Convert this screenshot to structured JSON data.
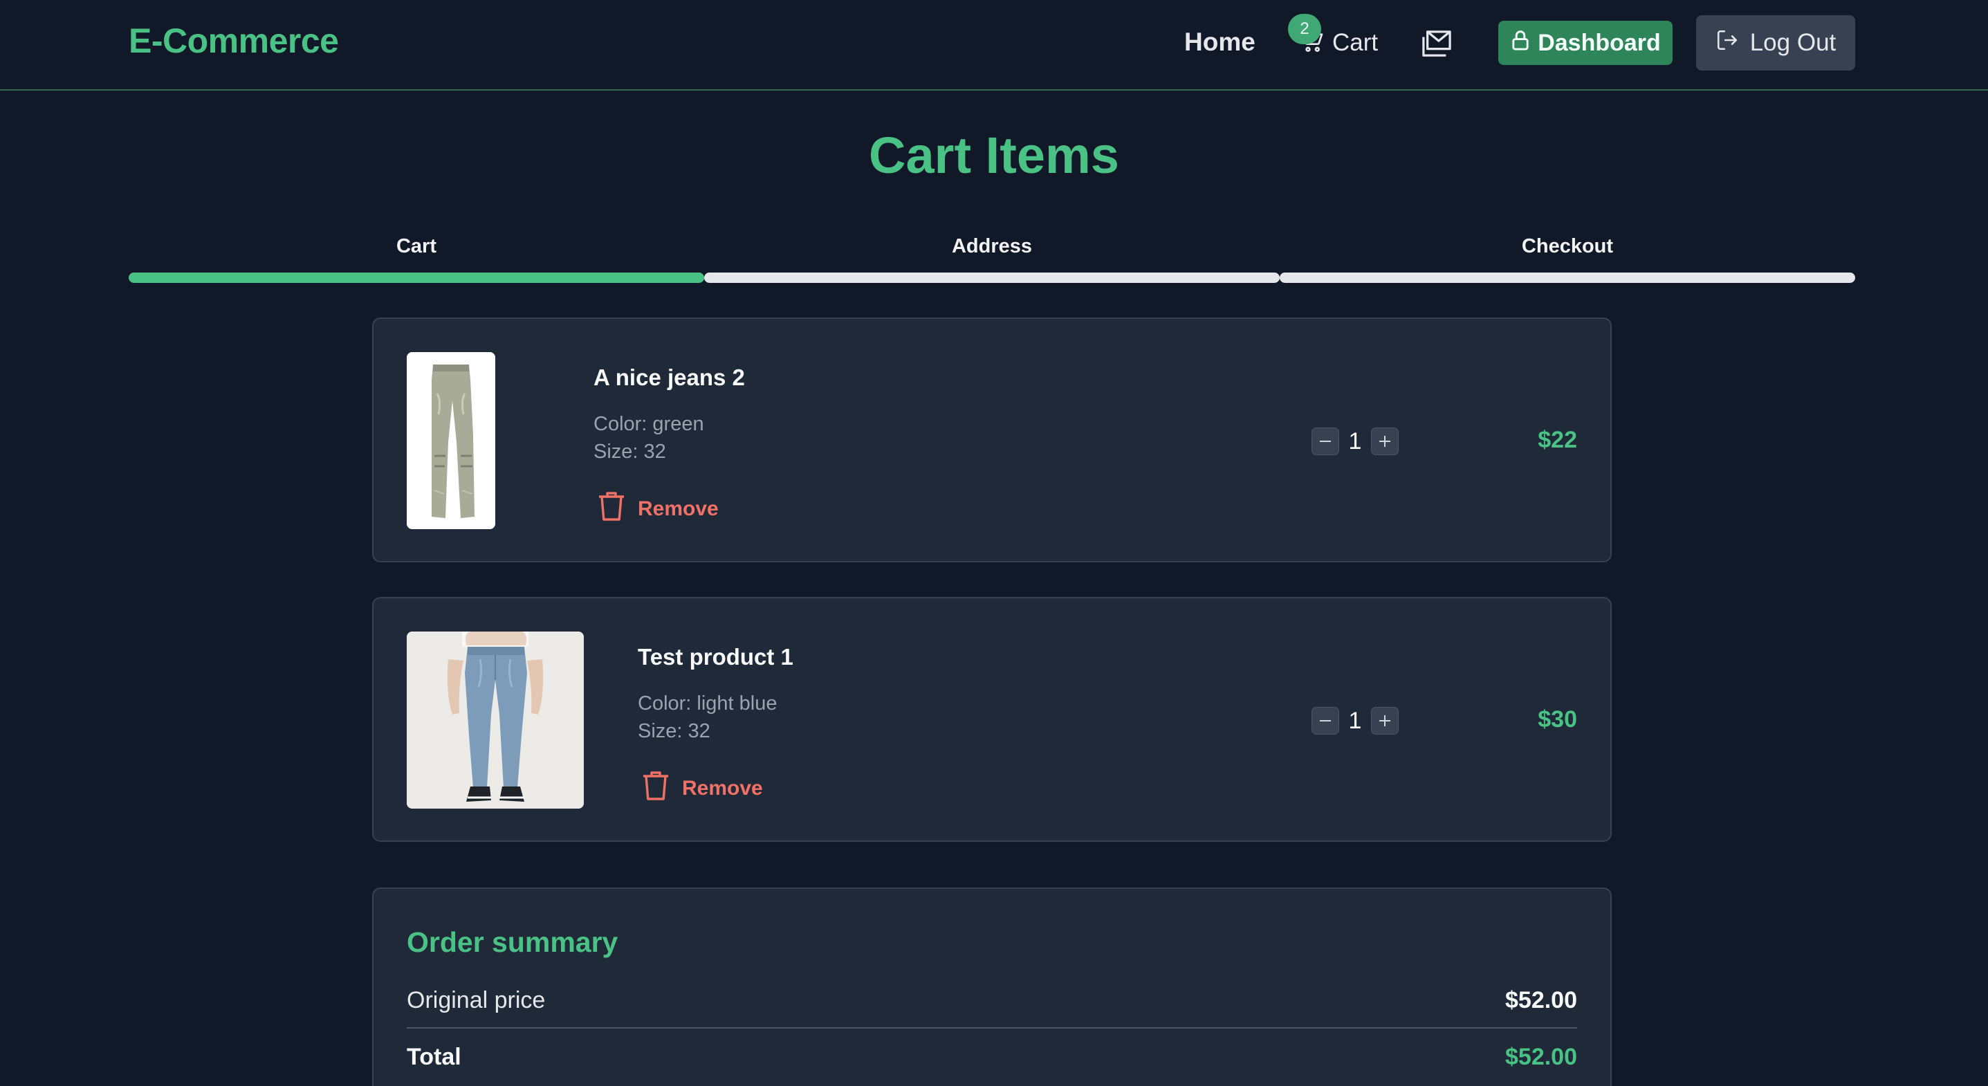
{
  "header": {
    "brand": "E-Commerce",
    "home_label": "Home",
    "cart_label": "Cart",
    "cart_count": "2",
    "dashboard_label": "Dashboard",
    "logout_label": "Log Out"
  },
  "page": {
    "title": "Cart Items"
  },
  "steps": [
    {
      "label": "Cart",
      "active": true
    },
    {
      "label": "Address",
      "active": false
    },
    {
      "label": "Checkout",
      "active": false
    }
  ],
  "items": [
    {
      "name": "A nice jeans 2",
      "color": "Color: green",
      "size": "Size: 32",
      "remove_label": "Remove",
      "quantity": "1",
      "price": "$22"
    },
    {
      "name": "Test product 1",
      "color": "Color: light blue",
      "size": "Size: 32",
      "remove_label": "Remove",
      "quantity": "1",
      "price": "$30"
    }
  ],
  "summary": {
    "title": "Order summary",
    "original_label": "Original price",
    "original_value": "$52.00",
    "total_label": "Total",
    "total_value": "$52.00"
  },
  "colors": {
    "accent": "#4ac286",
    "background": "#111827",
    "card": "#1f2937",
    "danger": "#f07167"
  }
}
